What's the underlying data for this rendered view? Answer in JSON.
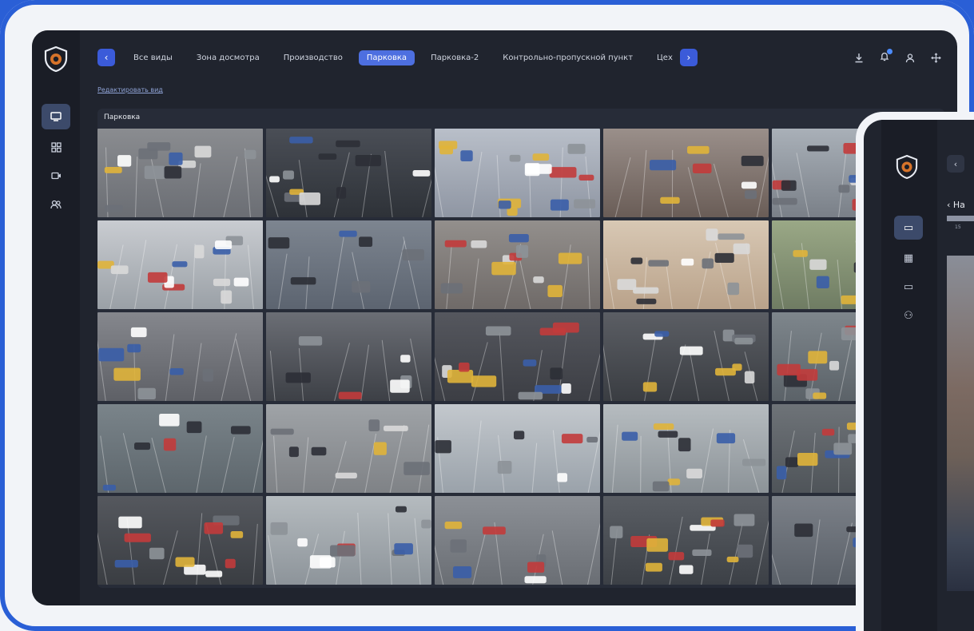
{
  "window": {
    "title": "Парковка"
  },
  "topbar": {
    "tabs": [
      {
        "label": "Все виды",
        "active": false
      },
      {
        "label": "Зона досмотра",
        "active": false
      },
      {
        "label": "Производство",
        "active": false
      },
      {
        "label": "Парковка",
        "active": true
      },
      {
        "label": "Парковка-2",
        "active": false
      },
      {
        "label": "Контрольно-пропускной пункт",
        "active": false
      },
      {
        "label": "Цех",
        "active": false
      }
    ],
    "prev_icon": "chevron-left-icon",
    "next_icon": "chevron-right-icon",
    "icons": [
      "download-icon",
      "bell-icon",
      "user-icon",
      "move-icon"
    ]
  },
  "sidebar": {
    "items": [
      {
        "icon": "monitor-icon",
        "active": true
      },
      {
        "icon": "grid-icon",
        "active": false
      },
      {
        "icon": "camera-icon",
        "active": false
      },
      {
        "icon": "users-icon",
        "active": false
      }
    ]
  },
  "edit_link": "Редактировать вид",
  "panel": {
    "title": "Парковка"
  },
  "overlay_device": {
    "back_label": "Ha",
    "number": "15"
  },
  "colors": {
    "accent": "#4d6fe0",
    "background": "#2a5fd6",
    "panel": "#20242e"
  }
}
